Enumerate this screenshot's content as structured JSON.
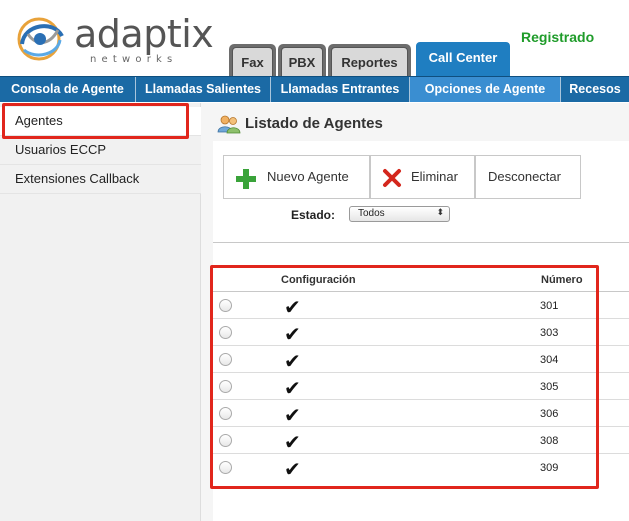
{
  "brand": {
    "name": "adaptix",
    "tagline": "networks",
    "colors": {
      "primary": "#1b6aa5",
      "accent": "#1f7ec1",
      "success": "#1f9c2a",
      "highlight": "#e1261c"
    }
  },
  "status": {
    "registered": "Registrado"
  },
  "module_tabs": [
    {
      "label": "Fax"
    },
    {
      "label": "PBX"
    },
    {
      "label": "Reportes"
    },
    {
      "label": "Call Center",
      "active": true
    }
  ],
  "nav": [
    {
      "label": "Consola de Agente"
    },
    {
      "label": "Llamadas Salientes"
    },
    {
      "label": "Llamadas Entrantes"
    },
    {
      "label": "Opciones de Agente",
      "active": true
    },
    {
      "label": "Recesos"
    }
  ],
  "sidebar": {
    "items": [
      {
        "label": "Agentes",
        "active": true
      },
      {
        "label": "Usuarios ECCP"
      },
      {
        "label": "Extensiones Callback"
      }
    ]
  },
  "main": {
    "title": "Listado de Agentes",
    "toolbar": {
      "new_label": "Nuevo Agente",
      "delete_label": "Eliminar",
      "disconnect_label": "Desconectar"
    },
    "filter": {
      "label": "Estado:",
      "selected": "Todos"
    },
    "table": {
      "columns": [
        "Configuración",
        "Número"
      ],
      "rows": [
        {
          "config": "✔",
          "number": "301"
        },
        {
          "config": "✔",
          "number": "303"
        },
        {
          "config": "✔",
          "number": "304"
        },
        {
          "config": "✔",
          "number": "305"
        },
        {
          "config": "✔",
          "number": "306"
        },
        {
          "config": "✔",
          "number": "308"
        },
        {
          "config": "✔",
          "number": "309"
        }
      ]
    }
  }
}
